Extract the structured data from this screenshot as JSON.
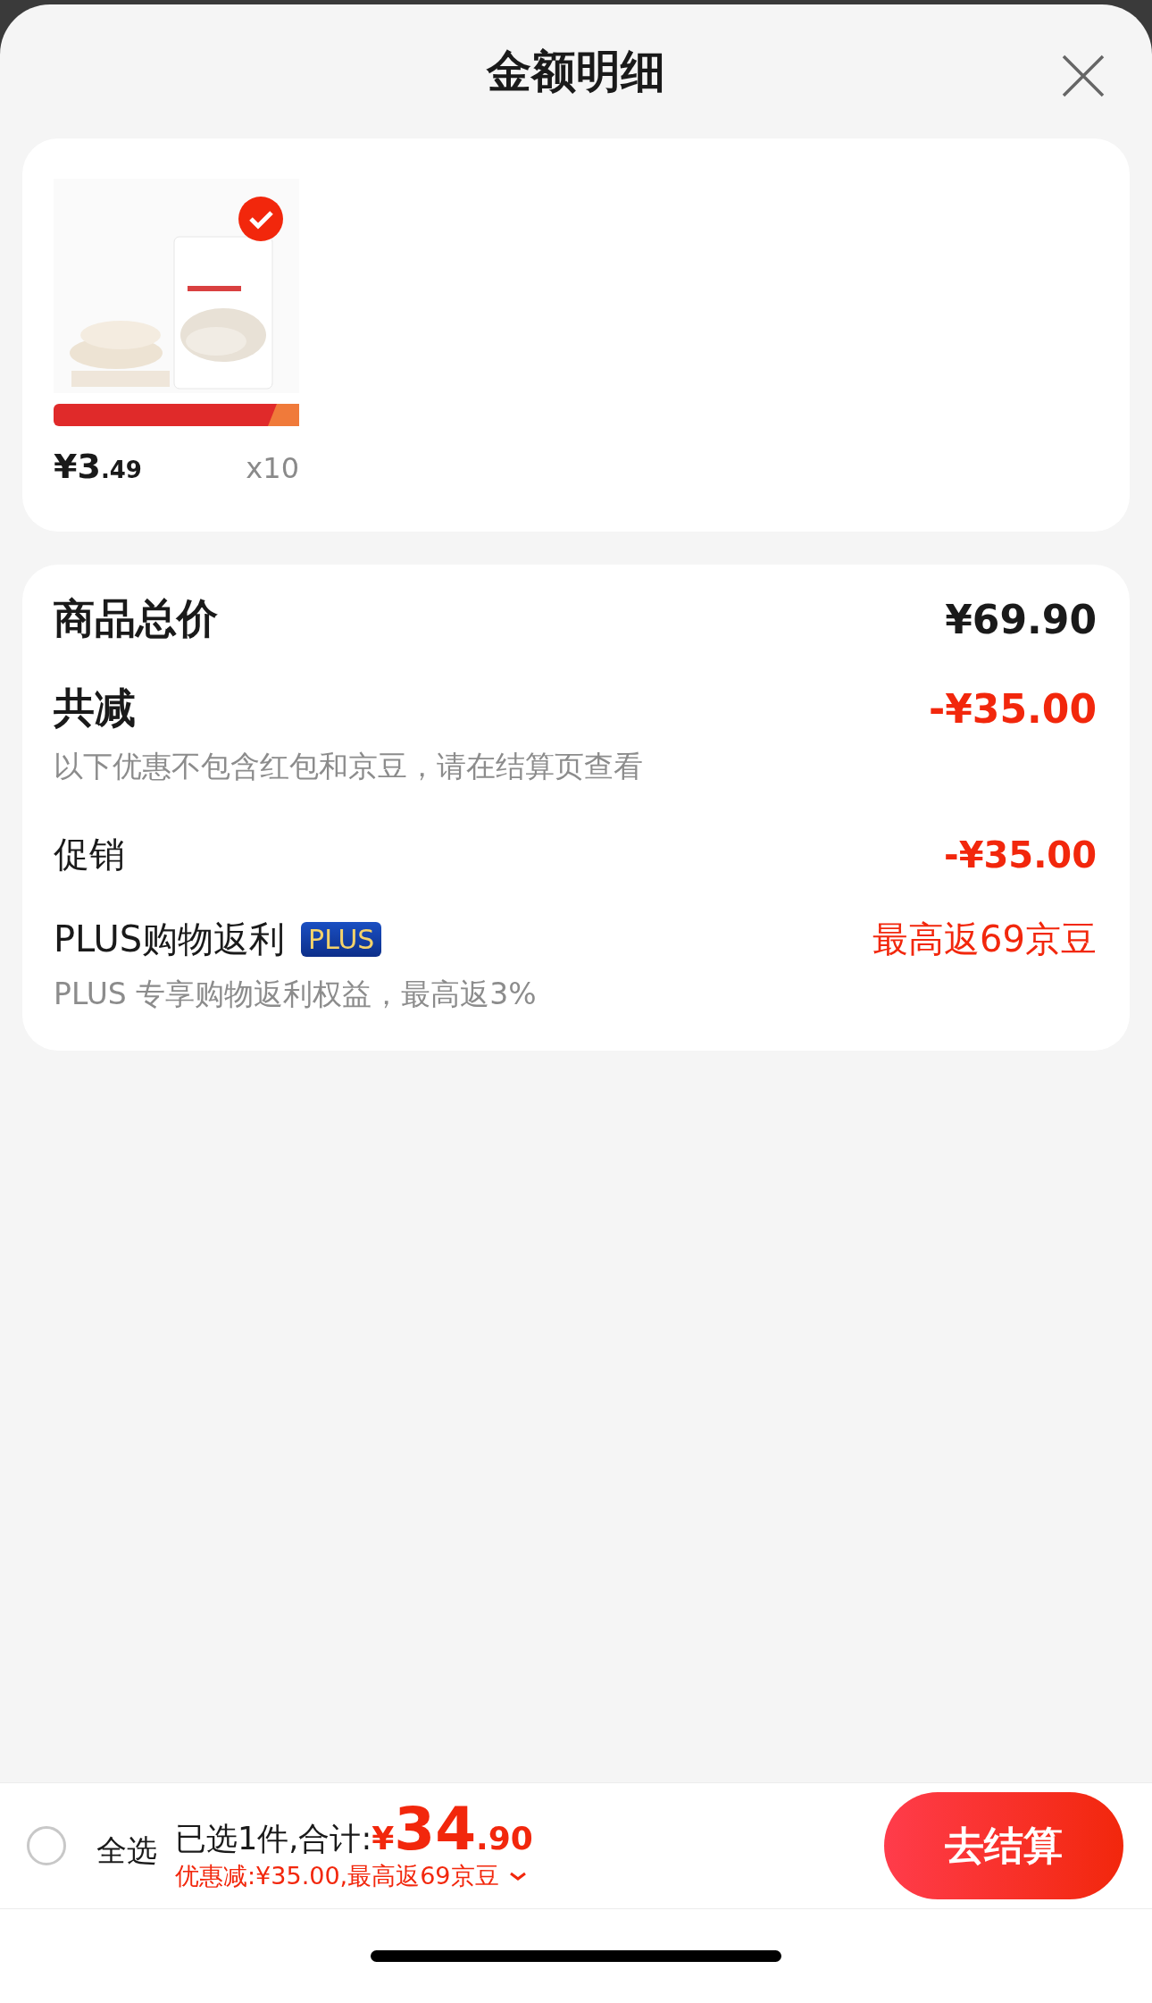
{
  "title": "金额明细",
  "items": [
    {
      "kind": "picture",
      "selected": true,
      "price_int": "¥3",
      "price_dec": ".49",
      "quantity": "x10"
    }
  ],
  "summary": {
    "rows": [
      {
        "kind": "total",
        "label": "商品总价",
        "value": "¥69.90"
      },
      {
        "kind": "discount",
        "label": "共减",
        "value": "-¥35.00",
        "note": "以下优惠不包含红包和京豆，请在结算页查看"
      },
      {
        "kind": "promo",
        "label": "促销",
        "value": "-¥35.00"
      },
      {
        "kind": "plus",
        "label": "PLUS购物返利",
        "badge": "PLUS",
        "value": "最高返69京豆",
        "note": "PLUS 专享购物返利权益，最高返3%"
      }
    ]
  },
  "footer": {
    "select_all": {
      "label": "全选",
      "checked": false
    },
    "selected_text": "已选1件,合计:",
    "currency": "¥",
    "total_int": "34",
    "total_dec": ".90",
    "savings": "优惠减:¥35.00,最高返69京豆",
    "checkout": "去结算"
  }
}
